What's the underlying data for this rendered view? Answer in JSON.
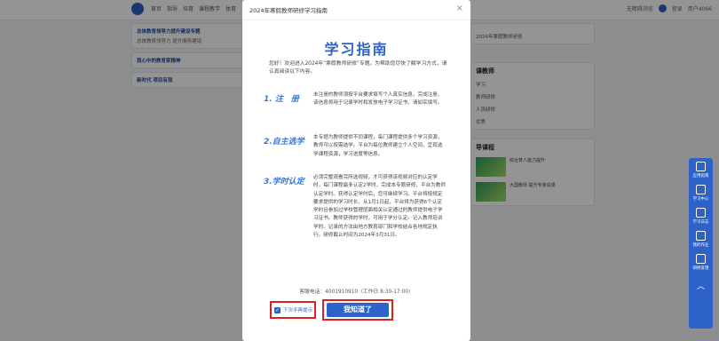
{
  "background": {
    "nav": [
      "首页",
      "指导",
      "培育",
      "课程教学",
      "体育"
    ],
    "right_links": [
      "无障碍浏览",
      "登录"
    ],
    "user_label": "用户4066",
    "left_cards": [
      {
        "title": "总体教育领导力提升建设专题",
        "sub": "总体教育领导力 提升服务建设"
      },
      {
        "title": "我心中的教育家精神",
        "sub": ""
      },
      {
        "title": "新时代 项目有我",
        "sub": ""
      }
    ],
    "right_cards": [
      {
        "heading": "",
        "lines": [
          "2024年寒假教师研修"
        ]
      },
      {
        "heading": "课教师",
        "lines": [
          "学习",
          "教师研修",
          "人员研修",
          "优秀"
        ]
      },
      {
        "heading": "导课程",
        "lines": [
          "综合育人能力提升",
          "大国教师 提升专家说课"
        ]
      }
    ],
    "sidebar": [
      "应用指南",
      "学习中心",
      "学习日志",
      "我的作业",
      "研修反馈"
    ]
  },
  "modal": {
    "title": "2024年寒假教师研修学习指南",
    "heading": "学习指南",
    "intro": "您好！欢迎进入2024年“寒假教师研修”专题。为帮助您尽快了解学习方式，请认真阅读以下内容。",
    "sections": [
      {
        "title": "1. 注　册",
        "body": "未注册的教师须按平台要求填写个人真实信息，完成注册。该信息将用于记录学时和发放电子学习证书，请如实填写。"
      },
      {
        "title": "2.自主选学",
        "body": "本专题为教师提供不同课程，每门课程提供多个学习资源，教师可以按需选学。平台为每位教师建立个人空间，呈现选学课程资源，学习进度等信息。"
      },
      {
        "title": "3.学时认定",
        "body": "必须完整观看完所选视频，才可获得该视频对应的认定学时，每门课程最多认定2学时，完成本专题研修，平台为教师认定学时。获得认定学时后，您可继续学习。平台将按规定要求提供的学习时长，从1月1日起，平台将为获得6个认定学时且参加过学校管理层面相关认定通过的教师提供电子学习证书。教师获得的学时，可用于学分认定。记入教师培训学时。记录的方法由地方教育部门和学校结合各地规定执行。研修截止时间为2024年3月31日。"
      }
    ],
    "hotline": "客服电话：4001910910（工作日 8:30-17:00）",
    "dont_show_label": "下次不再提示",
    "dont_show_checked": true,
    "confirm_label": "我知道了"
  },
  "colors": {
    "accent": "#2d63c8",
    "highlight": "#e02020"
  }
}
